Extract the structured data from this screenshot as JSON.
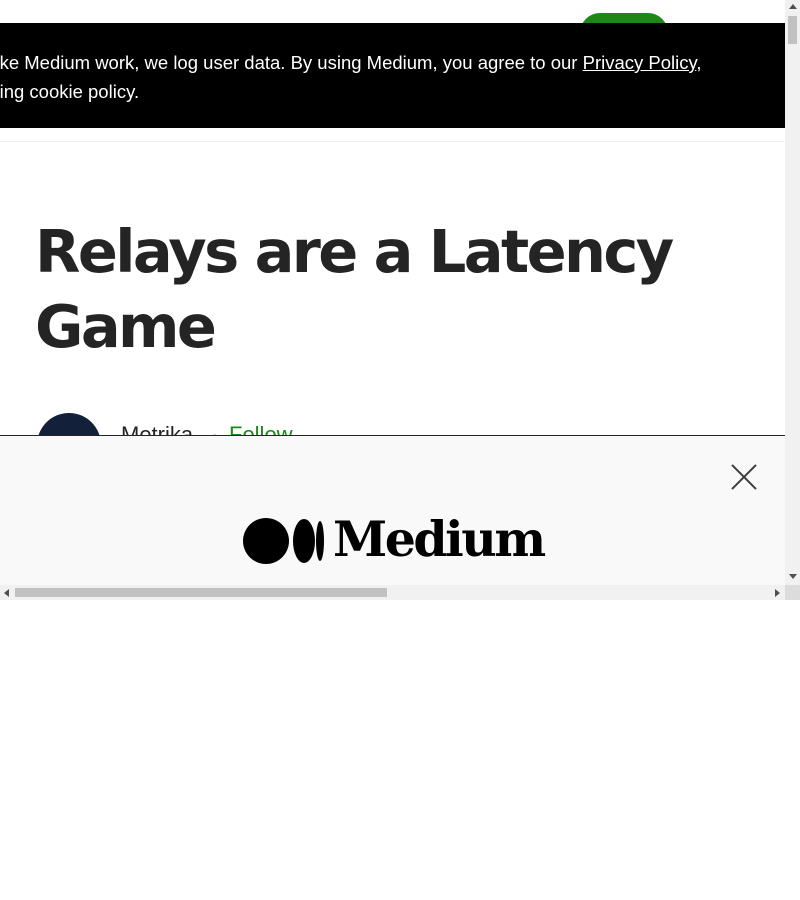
{
  "cookie_banner": {
    "text_before": "nake Medium work, we log user data. By using Medium, you agree to our ",
    "privacy_link": "Privacy Policy",
    "text_after": ",",
    "line2": "uding cookie policy."
  },
  "article": {
    "title": "Relays are a Latency Game",
    "author": "Metrika",
    "separator": "·",
    "follow_label": "Follow"
  },
  "signin_overlay": {
    "logo_text": "Medium"
  },
  "colors": {
    "brand_green": "#1a8917",
    "banner_bg": "#000000",
    "title_text": "#242424",
    "overlay_bg": "#f9f9f9"
  },
  "icons": {
    "close": "close-icon",
    "logo": "medium-logo-icon"
  }
}
